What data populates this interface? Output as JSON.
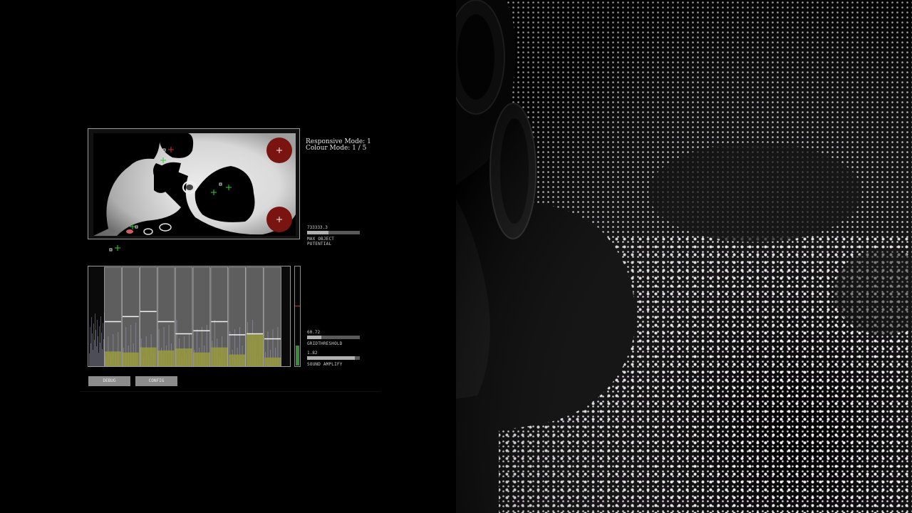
{
  "status": {
    "responsive_mode": "Responsive Mode: 1",
    "colour_mode": "Colour Mode: 1 / 5"
  },
  "sliders": [
    {
      "value": "733333.3",
      "label": "MAX OBJECT POTENTIAL",
      "fill": 0.4
    },
    {
      "value": "60.72",
      "label": "GRIDTHRESHOLD",
      "fill": 0.27
    },
    {
      "value": "1.82",
      "label": "SOUND AMPLIFY",
      "fill": 0.9
    }
  ],
  "buttons": {
    "debug": "DEBUG",
    "config": "CONFIG"
  },
  "sound_grid": {
    "column_thresholds": [
      0.46,
      0.51,
      0.56,
      0.46,
      0.34,
      0.37,
      0.46,
      0.33,
      0.34,
      0.29
    ],
    "column_levels": [
      0.16,
      0.15,
      0.2,
      0.17,
      0.19,
      0.15,
      0.2,
      0.13,
      0.33,
      0.1
    ],
    "level_meter": 0.2,
    "level_peak": 0.6
  },
  "colors": {
    "background": "#000000",
    "frame": "#9a9a9a",
    "column": "#5e5e5e",
    "sound_fill": "#9a9a40",
    "attractor": "#7a1410",
    "marker_green": "#33cc33",
    "marker_red": "#cc3333",
    "meter": "#3d8a3d",
    "led": "#f2eef2"
  }
}
